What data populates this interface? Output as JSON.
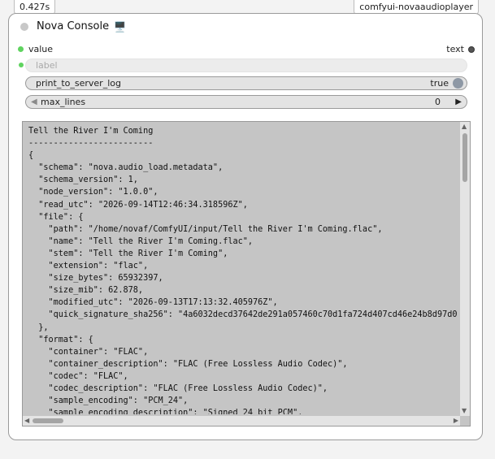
{
  "badges": {
    "timing": "0.427s",
    "pack": "comfyui-novaaudioplayer"
  },
  "node": {
    "title": "Nova Console",
    "title_emoji": "🖥️",
    "input_port": "value",
    "output_port": "text",
    "colors": {
      "input_port": "#5fd35f",
      "output_port": "#555555"
    }
  },
  "widgets": {
    "label_placeholder": "label",
    "print_to_server_log": {
      "name": "print_to_server_log",
      "value": "true"
    },
    "max_lines": {
      "name": "max_lines",
      "value": "0"
    }
  },
  "console": {
    "lines": [
      "Tell the River I'm Coming",
      "-------------------------",
      "{",
      "  \"schema\": \"nova.audio_load.metadata\",",
      "  \"schema_version\": 1,",
      "  \"node_version\": \"1.0.0\",",
      "  \"read_utc\": \"2026-09-14T12:46:34.318596Z\",",
      "  \"file\": {",
      "    \"path\": \"/home/novaf/ComfyUI/input/Tell the River I'm Coming.flac\",",
      "    \"name\": \"Tell the River I'm Coming.flac\",",
      "    \"stem\": \"Tell the River I'm Coming\",",
      "    \"extension\": \"flac\",",
      "    \"size_bytes\": 65932397,",
      "    \"size_mib\": 62.878,",
      "    \"modified_utc\": \"2026-09-13T17:13:32.405976Z\",",
      "    \"quick_signature_sha256\": \"4a6032decd37642de291a057460c70d1fa724d407cd46e24b8d97d0",
      "  },",
      "  \"format\": {",
      "    \"container\": \"FLAC\",",
      "    \"container_description\": \"FLAC (Free Lossless Audio Codec)\",",
      "    \"codec\": \"FLAC\",",
      "    \"codec_description\": \"FLAC (Free Lossless Audio Codec)\",",
      "    \"sample_encoding\": \"PCM_24\",",
      "    \"sample_encoding_description\": \"Signed 24 bit PCM\","
    ]
  }
}
